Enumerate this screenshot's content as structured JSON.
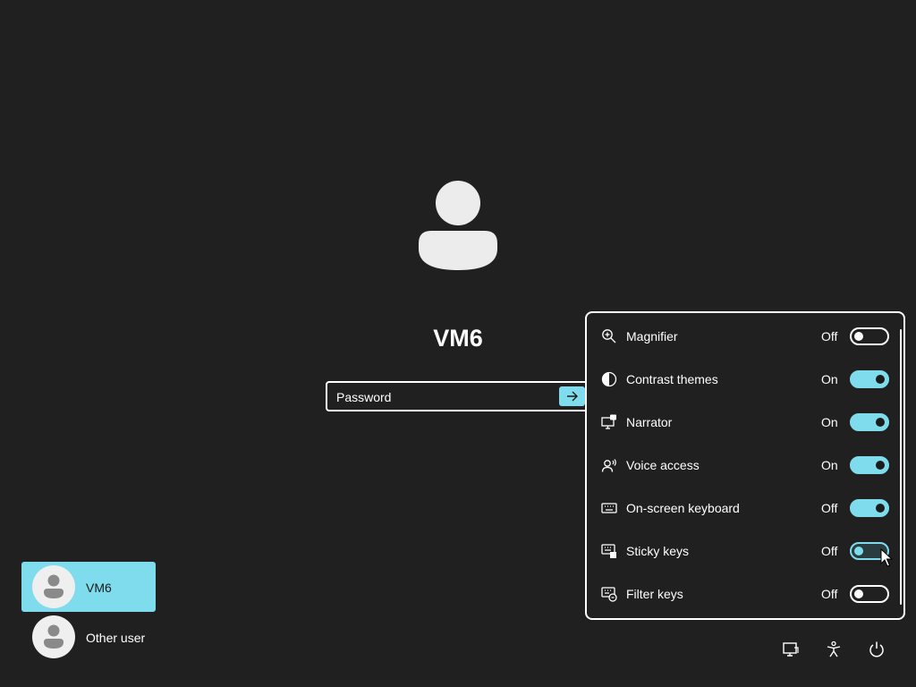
{
  "login": {
    "user_name": "VM6",
    "password_placeholder": "Password"
  },
  "accessibility_panel": {
    "items": [
      {
        "label": "Magnifier",
        "state": "Off",
        "toggle": "off",
        "icon": "magnifier-icon"
      },
      {
        "label": "Contrast themes",
        "state": "On",
        "toggle": "on",
        "icon": "contrast-icon"
      },
      {
        "label": "Narrator",
        "state": "On",
        "toggle": "on",
        "icon": "narrator-icon"
      },
      {
        "label": "Voice access",
        "state": "On",
        "toggle": "on",
        "icon": "voice-access-icon"
      },
      {
        "label": "On-screen keyboard",
        "state": "Off",
        "toggle": "on",
        "icon": "keyboard-icon"
      },
      {
        "label": "Sticky keys",
        "state": "Off",
        "toggle": "hover",
        "icon": "sticky-keys-icon"
      },
      {
        "label": "Filter keys",
        "state": "Off",
        "toggle": "off",
        "icon": "filter-keys-icon"
      }
    ]
  },
  "users": [
    {
      "name": "VM6",
      "selected": true
    },
    {
      "name": "Other user",
      "selected": false
    }
  ],
  "corner_buttons": [
    "network-icon",
    "accessibility-icon",
    "power-icon"
  ],
  "colors": {
    "background": "#202020",
    "accent": "#7edcec",
    "text": "#ffffff"
  }
}
